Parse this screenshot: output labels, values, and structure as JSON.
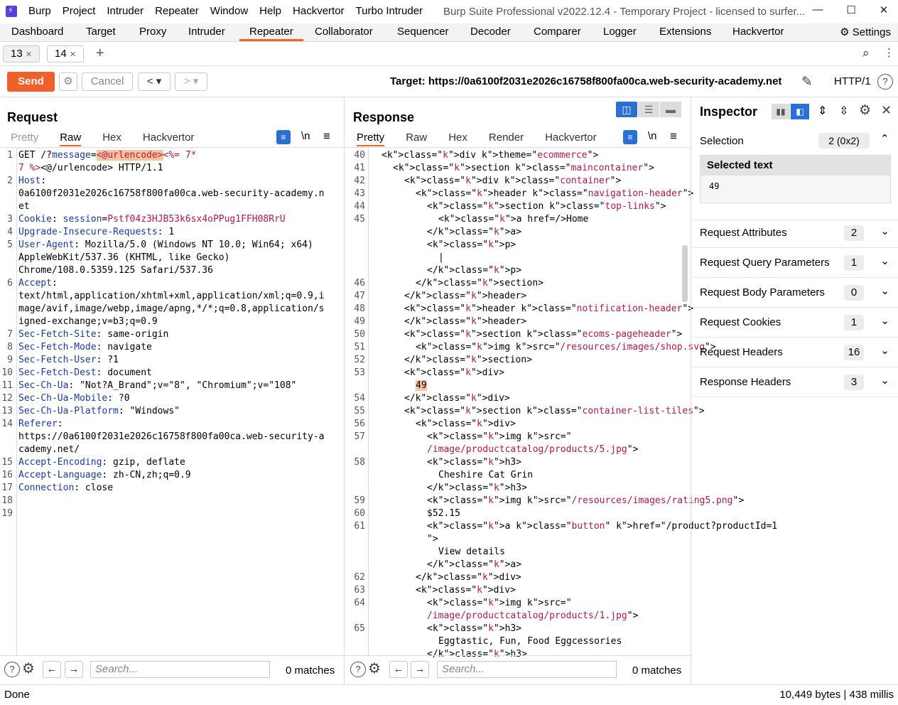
{
  "titlebar": {
    "menu": [
      "Burp",
      "Project",
      "Intruder",
      "Repeater",
      "Window",
      "Help",
      "Hackvertor",
      "Turbo Intruder"
    ],
    "window_title": "Burp Suite Professional v2022.12.4 - Temporary Project - licensed to surfer..."
  },
  "main_tabs": [
    "Dashboard",
    "Target",
    "Proxy",
    "Intruder",
    "Repeater",
    "Collaborator",
    "Sequencer",
    "Decoder",
    "Comparer",
    "Logger",
    "Extensions",
    "Hackvertor"
  ],
  "active_main_tab": "Repeater",
  "settings_label": "Settings",
  "sub_tabs": [
    {
      "label": "13"
    },
    {
      "label": "14"
    }
  ],
  "toolbar": {
    "send": "Send",
    "cancel": "Cancel",
    "target_label": "Target: https://0a6100f2031e2026c16758f800fa00ca.web-security-academy.net",
    "http_version": "HTTP/1"
  },
  "request": {
    "title": "Request",
    "tabs": [
      "Pretty",
      "Raw",
      "Hex",
      "Hackvertor"
    ],
    "active_tab": "Raw",
    "newline_toggle": "\\n",
    "search_placeholder": "Search...",
    "matches": "0 matches",
    "lines": [
      {
        "n": "1",
        "text": "GET /?message=<@urlencode><%= 7*"
      },
      {
        "n": "",
        "text": "7 %><@/urlencode> HTTP/1.1"
      },
      {
        "n": "2",
        "text": "Host:"
      },
      {
        "n": "",
        "text": "0a6100f2031e2026c16758f800fa00ca.web-security-academy.n"
      },
      {
        "n": "",
        "text": "et"
      },
      {
        "n": "3",
        "text": "Cookie: session=Pstf04z3HJB53k6sx4oPPug1FFH08RrU"
      },
      {
        "n": "4",
        "text": "Upgrade-Insecure-Requests: 1"
      },
      {
        "n": "5",
        "text": "User-Agent: Mozilla/5.0 (Windows NT 10.0; Win64; x64)"
      },
      {
        "n": "",
        "text": "AppleWebKit/537.36 (KHTML, like Gecko)"
      },
      {
        "n": "",
        "text": "Chrome/108.0.5359.125 Safari/537.36"
      },
      {
        "n": "6",
        "text": "Accept:"
      },
      {
        "n": "",
        "text": "text/html,application/xhtml+xml,application/xml;q=0.9,i"
      },
      {
        "n": "",
        "text": "mage/avif,image/webp,image/apng,*/*;q=0.8,application/s"
      },
      {
        "n": "",
        "text": "igned-exchange;v=b3;q=0.9"
      },
      {
        "n": "7",
        "text": "Sec-Fetch-Site: same-origin"
      },
      {
        "n": "8",
        "text": "Sec-Fetch-Mode: navigate"
      },
      {
        "n": "9",
        "text": "Sec-Fetch-User: ?1"
      },
      {
        "n": "10",
        "text": "Sec-Fetch-Dest: document"
      },
      {
        "n": "11",
        "text": "Sec-Ch-Ua: \"Not?A_Brand\";v=\"8\", \"Chromium\";v=\"108\""
      },
      {
        "n": "12",
        "text": "Sec-Ch-Ua-Mobile: ?0"
      },
      {
        "n": "13",
        "text": "Sec-Ch-Ua-Platform: \"Windows\""
      },
      {
        "n": "14",
        "text": "Referer:"
      },
      {
        "n": "",
        "text": "https://0a6100f2031e2026c16758f800fa00ca.web-security-a"
      },
      {
        "n": "",
        "text": "cademy.net/"
      },
      {
        "n": "15",
        "text": "Accept-Encoding: gzip, deflate"
      },
      {
        "n": "16",
        "text": "Accept-Language: zh-CN,zh;q=0.9"
      },
      {
        "n": "17",
        "text": "Connection: close"
      },
      {
        "n": "18",
        "text": ""
      },
      {
        "n": "19",
        "text": ""
      }
    ]
  },
  "response": {
    "title": "Response",
    "tabs": [
      "Pretty",
      "Raw",
      "Hex",
      "Render",
      "Hackvertor"
    ],
    "active_tab": "Pretty",
    "newline_toggle": "\\n",
    "search_placeholder": "Search...",
    "matches": "0 matches",
    "lines": [
      {
        "n": "40",
        "indent": 1,
        "text": "<div theme=\"ecommerce\">"
      },
      {
        "n": "41",
        "indent": 2,
        "text": "<section class=\"maincontainer\">"
      },
      {
        "n": "42",
        "indent": 3,
        "text": "<div class=\"container\">"
      },
      {
        "n": "43",
        "indent": 4,
        "text": "<header class=\"navigation-header\">"
      },
      {
        "n": "44",
        "indent": 5,
        "text": "<section class=\"top-links\">"
      },
      {
        "n": "45",
        "indent": 6,
        "text": "<a href=/>Home"
      },
      {
        "n": "",
        "indent": 5,
        "text": "</a>"
      },
      {
        "n": "",
        "indent": 5,
        "text": "<p>"
      },
      {
        "n": "",
        "indent": 6,
        "text": "|"
      },
      {
        "n": "",
        "indent": 5,
        "text": "</p>"
      },
      {
        "n": "46",
        "indent": 4,
        "text": "</section>"
      },
      {
        "n": "47",
        "indent": 3,
        "text": "</header>"
      },
      {
        "n": "48",
        "indent": 3,
        "text": "<header class=\"notification-header\">"
      },
      {
        "n": "49",
        "indent": 3,
        "text": "</header>"
      },
      {
        "n": "50",
        "indent": 3,
        "text": "<section class=\"ecoms-pageheader\">"
      },
      {
        "n": "51",
        "indent": 4,
        "text": "<img src=\"/resources/images/shop.svg\">"
      },
      {
        "n": "52",
        "indent": 3,
        "text": "</section>"
      },
      {
        "n": "53",
        "indent": 3,
        "text": "<div>"
      },
      {
        "n": "",
        "indent": 4,
        "text": "49"
      },
      {
        "n": "54",
        "indent": 3,
        "text": "</div>"
      },
      {
        "n": "55",
        "indent": 3,
        "text": "<section class=\"container-list-tiles\">"
      },
      {
        "n": "56",
        "indent": 4,
        "text": "<div>"
      },
      {
        "n": "57",
        "indent": 5,
        "text": "<img src=\""
      },
      {
        "n": "",
        "indent": 5,
        "text": "/image/productcatalog/products/5.jpg\">"
      },
      {
        "n": "58",
        "indent": 5,
        "text": "<h3>"
      },
      {
        "n": "",
        "indent": 6,
        "text": "Cheshire Cat Grin"
      },
      {
        "n": "",
        "indent": 5,
        "text": "</h3>"
      },
      {
        "n": "59",
        "indent": 5,
        "text": "<img src=\"/resources/images/rating5.png\">"
      },
      {
        "n": "60",
        "indent": 5,
        "text": "$52.15"
      },
      {
        "n": "61",
        "indent": 5,
        "text": "<a class=\"button\" href=\"/product?productId=1"
      },
      {
        "n": "",
        "indent": 5,
        "text": "\">"
      },
      {
        "n": "",
        "indent": 6,
        "text": "View details"
      },
      {
        "n": "",
        "indent": 5,
        "text": "</a>"
      },
      {
        "n": "62",
        "indent": 4,
        "text": "</div>"
      },
      {
        "n": "63",
        "indent": 4,
        "text": "<div>"
      },
      {
        "n": "64",
        "indent": 5,
        "text": "<img src=\""
      },
      {
        "n": "",
        "indent": 5,
        "text": "/image/productcatalog/products/1.jpg\">"
      },
      {
        "n": "65",
        "indent": 5,
        "text": "<h3>"
      },
      {
        "n": "",
        "indent": 6,
        "text": "Eggtastic, Fun, Food Eggcessories"
      },
      {
        "n": "",
        "indent": 5,
        "text": "</h3>"
      }
    ]
  },
  "inspector": {
    "title": "Inspector",
    "selection_label": "Selection",
    "selection_count": "2 (0x2)",
    "selected_text_label": "Selected text",
    "selected_text_value": "49",
    "sections": [
      {
        "label": "Request Attributes",
        "count": "2"
      },
      {
        "label": "Request Query Parameters",
        "count": "1"
      },
      {
        "label": "Request Body Parameters",
        "count": "0"
      },
      {
        "label": "Request Cookies",
        "count": "1"
      },
      {
        "label": "Request Headers",
        "count": "16"
      },
      {
        "label": "Response Headers",
        "count": "3"
      }
    ]
  },
  "status": {
    "left": "Done",
    "right": "10,449 bytes | 438 millis"
  },
  "colors": {
    "accent": "#f06529",
    "send": "#f0602a",
    "keyword": "#1a3aa8",
    "value": "#b5174b",
    "highlight": "#f9c49d"
  }
}
